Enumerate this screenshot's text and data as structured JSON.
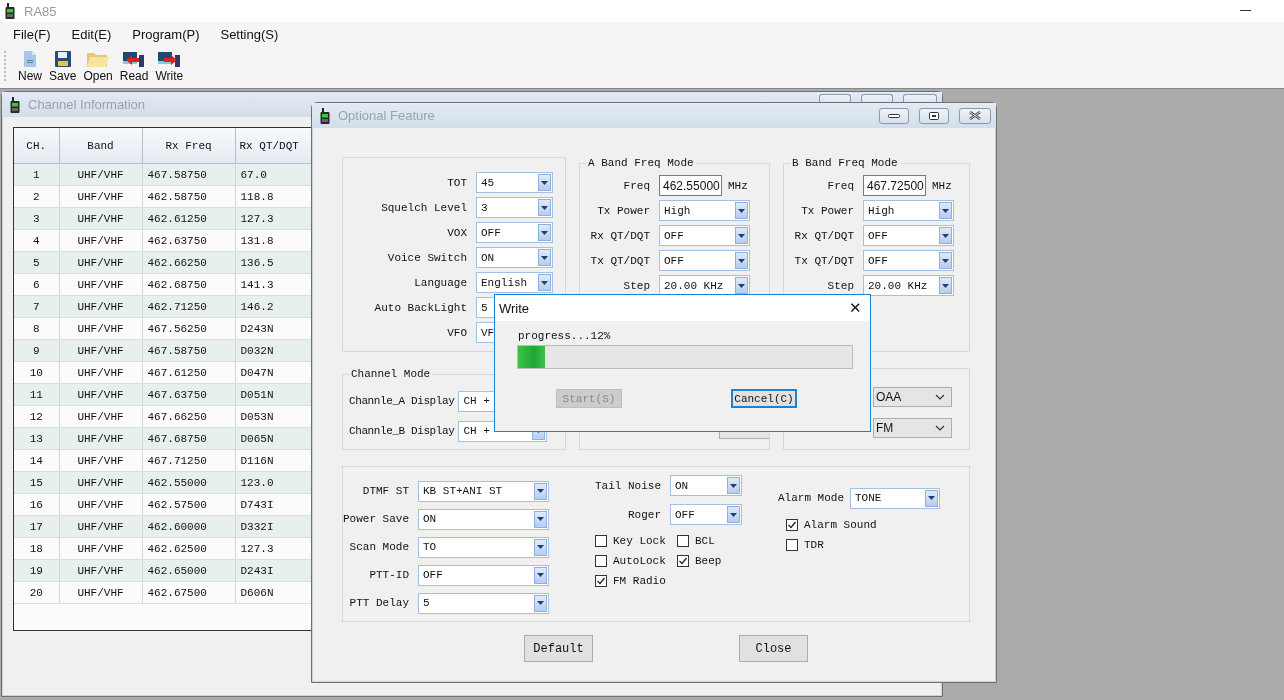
{
  "app": {
    "title": "RA85"
  },
  "menu": [
    "File(F)",
    "Edit(E)",
    "Program(P)",
    "Setting(S)"
  ],
  "toolbar": [
    {
      "label": "New",
      "kind": "new"
    },
    {
      "label": "Save",
      "kind": "save"
    },
    {
      "label": "Open",
      "kind": "open"
    },
    {
      "label": "Read",
      "kind": "read"
    },
    {
      "label": "Write",
      "kind": "write"
    }
  ],
  "channel_window": {
    "title": "Channel Information",
    "columns": [
      "CH.",
      "Band",
      "Rx Freq",
      "Rx QT/DQT"
    ],
    "rows": [
      [
        "1",
        "UHF/VHF",
        "467.58750",
        "67.0"
      ],
      [
        "2",
        "UHF/VHF",
        "462.58750",
        "118.8"
      ],
      [
        "3",
        "UHF/VHF",
        "462.61250",
        "127.3"
      ],
      [
        "4",
        "UHF/VHF",
        "462.63750",
        "131.8"
      ],
      [
        "5",
        "UHF/VHF",
        "462.66250",
        "136.5"
      ],
      [
        "6",
        "UHF/VHF",
        "462.68750",
        "141.3"
      ],
      [
        "7",
        "UHF/VHF",
        "462.71250",
        "146.2"
      ],
      [
        "8",
        "UHF/VHF",
        "467.56250",
        "D243N"
      ],
      [
        "9",
        "UHF/VHF",
        "467.58750",
        "D032N"
      ],
      [
        "10",
        "UHF/VHF",
        "467.61250",
        "D047N"
      ],
      [
        "11",
        "UHF/VHF",
        "467.63750",
        "D051N"
      ],
      [
        "12",
        "UHF/VHF",
        "467.66250",
        "D053N"
      ],
      [
        "13",
        "UHF/VHF",
        "467.68750",
        "D065N"
      ],
      [
        "14",
        "UHF/VHF",
        "467.71250",
        "D116N"
      ],
      [
        "15",
        "UHF/VHF",
        "462.55000",
        "123.0"
      ],
      [
        "16",
        "UHF/VHF",
        "462.57500",
        "D743I"
      ],
      [
        "17",
        "UHF/VHF",
        "462.60000",
        "D332I"
      ],
      [
        "18",
        "UHF/VHF",
        "462.62500",
        "127.3"
      ],
      [
        "19",
        "UHF/VHF",
        "462.65000",
        "D243I"
      ],
      [
        "20",
        "UHF/VHF",
        "462.67500",
        "D606N"
      ]
    ]
  },
  "optional_feature": {
    "title": "Optional Feature",
    "general": [
      {
        "label": "TOT",
        "value": "45"
      },
      {
        "label": "Squelch Level",
        "value": "3"
      },
      {
        "label": "VOX",
        "value": "OFF"
      },
      {
        "label": "Voice Switch",
        "value": "ON"
      },
      {
        "label": "Language",
        "value": "English"
      },
      {
        "label": "Auto BackLight",
        "value": "5"
      },
      {
        "label": "VFO",
        "value": "VF"
      }
    ],
    "bands": [
      {
        "legend": "A Band Freq Mode",
        "freq_label": "Freq",
        "freq": "462.55000",
        "unit": "MHz",
        "fields": [
          {
            "label": "Tx Power",
            "value": "High"
          },
          {
            "label": "Rx QT/DQT",
            "value": "OFF"
          },
          {
            "label": "Tx QT/DQT",
            "value": "OFF"
          },
          {
            "label": "Step",
            "value": "20.00 KHz"
          }
        ]
      },
      {
        "legend": "B Band Freq Mode",
        "freq_label": "Freq",
        "freq": "467.72500",
        "unit": "MHz",
        "fields": [
          {
            "label": "Tx Power",
            "value": "High"
          },
          {
            "label": "Rx QT/DQT",
            "value": "OFF"
          },
          {
            "label": "Tx QT/DQT",
            "value": "OFF"
          },
          {
            "label": "Step",
            "value": "20.00 KHz"
          }
        ]
      }
    ],
    "channel_mode": {
      "legend": "Channel Mode",
      "fields": [
        {
          "label": "Channle_A Display",
          "value": "CH +"
        },
        {
          "label": "Channle_B Display",
          "value": "CH +"
        }
      ],
      "right": [
        "OAA",
        "FM"
      ]
    },
    "extras_left": [
      {
        "label": "DTMF ST",
        "value": "KB ST+ANI ST"
      },
      {
        "label": "Power Save",
        "value": "ON"
      },
      {
        "label": "Scan Mode",
        "value": "TO"
      },
      {
        "label": "PTT-ID",
        "value": "OFF"
      },
      {
        "label": "PTT Delay",
        "value": "5"
      }
    ],
    "extras_mid": [
      {
        "label": "Tail Noise",
        "value": "ON"
      },
      {
        "label": "Roger",
        "value": "OFF"
      }
    ],
    "checks_mid": [
      {
        "label": "Key Lock",
        "checked": false
      },
      {
        "label": "BCL",
        "checked": false
      },
      {
        "label": "AutoLock",
        "checked": false
      },
      {
        "label": "Beep",
        "checked": true
      },
      {
        "label": "FM Radio",
        "checked": true
      }
    ],
    "alarm_mode": {
      "label": "Alarm Mode",
      "value": "TONE"
    },
    "checks_right": [
      {
        "label": "Alarm Sound",
        "checked": true
      },
      {
        "label": "TDR",
        "checked": false
      }
    ],
    "buttons": [
      "Default",
      "Close"
    ]
  },
  "write_dialog": {
    "title": "Write",
    "close": "✕",
    "status": "progress...12%",
    "level": 0.08,
    "buttons": [
      {
        "label": "Start(S)",
        "disabled": true,
        "focused": false
      },
      {
        "label": "Cancel(C)",
        "disabled": false,
        "focused": true
      }
    ]
  }
}
